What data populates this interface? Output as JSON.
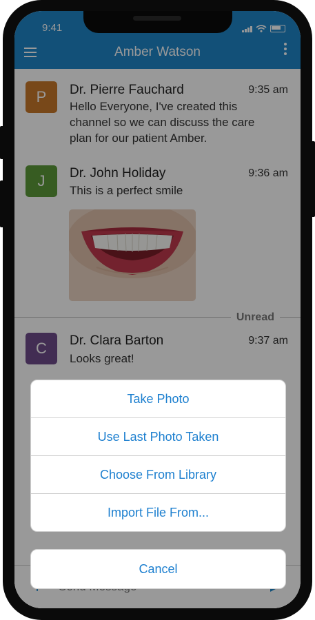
{
  "status": {
    "time": "9:41"
  },
  "header": {
    "title": "Amber Watson"
  },
  "messages": [
    {
      "initial": "P",
      "avatar_color": "#c9782b",
      "sender": "Dr. Pierre Fauchard",
      "time": "9:35 am",
      "text": "Hello Everyone, I've created this channel so we can discuss the care plan for our patient Amber."
    },
    {
      "initial": "J",
      "avatar_color": "#5d9a3a",
      "sender": "Dr. John Holiday",
      "time": "9:36 am",
      "text": "This is a perfect smile"
    },
    {
      "initial": "C",
      "avatar_color": "#6e4b8a",
      "sender": "Dr. Clara Barton",
      "time": "9:37 am",
      "text": "Looks great!"
    }
  ],
  "divider": {
    "label": "Unread"
  },
  "composer": {
    "placeholder": "Send Message"
  },
  "action_sheet": {
    "items": [
      "Take Photo",
      "Use Last Photo Taken",
      "Choose From Library",
      "Import File From..."
    ],
    "cancel": "Cancel"
  },
  "colors": {
    "accent": "#1f86c9",
    "action_text": "#1c7fcf"
  },
  "icons": [
    "menu-icon",
    "more-vertical-icon",
    "signal-icon",
    "wifi-icon",
    "battery-icon",
    "plus-icon",
    "send-icon"
  ]
}
